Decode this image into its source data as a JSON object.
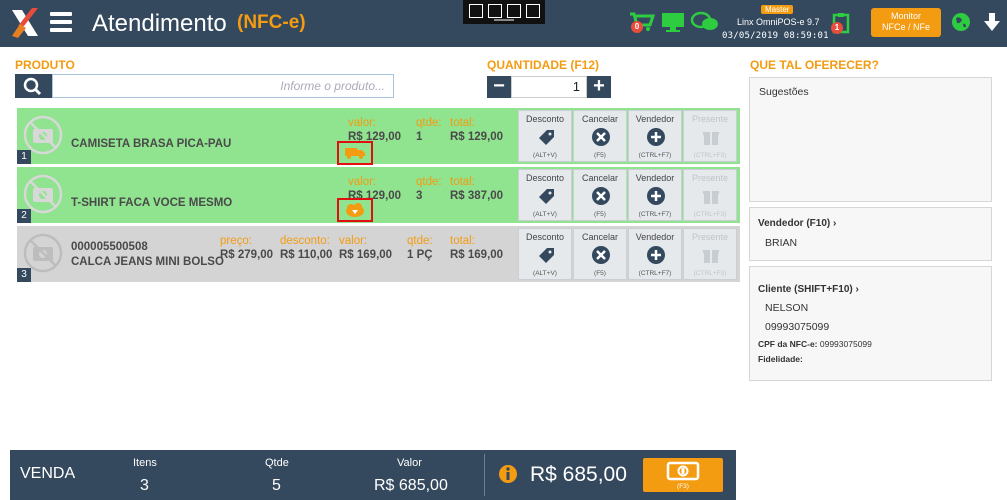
{
  "header": {
    "title": "Atendimento",
    "subtitle": "(NFC-e)",
    "cart_badge": "0",
    "notice_badge": "1",
    "master_badge": "Master",
    "app_version": "Linx OmniPOS-e  9.7",
    "datetime": "03/05/2019 08:59:01",
    "monitor_line1": "Monitor",
    "monitor_line2": "NFCe / NFe"
  },
  "search": {
    "label": "PRODUTO",
    "placeholder": "Informe o produto..."
  },
  "quantity": {
    "label": "QUANTIDADE (F12)",
    "value": "1"
  },
  "labels": {
    "valor": "valor:",
    "qtde": "qtde:",
    "total": "total:",
    "preco": "preço:",
    "desconto": "desconto:"
  },
  "actions": {
    "desconto": {
      "label": "Desconto",
      "key": "(ALT+V)"
    },
    "cancelar": {
      "label": "Cancelar",
      "key": "(F5)"
    },
    "vendedor": {
      "label": "Vendedor",
      "key": "(CTRL+F7)"
    },
    "presente": {
      "label": "Presente",
      "key": "(CTRL+F3)"
    }
  },
  "items": [
    {
      "index": "1",
      "name": "CAMISETA BRASA PICA-PAU",
      "valor": "R$ 129,00",
      "qtde": "1",
      "total": "R$ 129,00"
    },
    {
      "index": "2",
      "name": "T-SHIRT FACA VOCE MESMO",
      "valor": "R$ 129,00",
      "qtde": "3",
      "total": "R$ 387,00"
    },
    {
      "index": "3",
      "code": "000005500508",
      "name": "CALCA JEANS MINI BOLSO",
      "preco": "R$ 279,00",
      "desconto": "R$ 110,00",
      "valor": "R$ 169,00",
      "qtde": "1 PÇ",
      "total": "R$ 169,00"
    }
  ],
  "right_panel": {
    "heading": "QUE TAL OFERECER?",
    "sugestoes": "Sugestões",
    "vendedor_title": "Vendedor (F10)",
    "vendedor_name": "BRIAN",
    "cliente_title": "Cliente (SHIFT+F10)",
    "cliente_name": "NELSON",
    "cliente_phone": "09993075099",
    "cpf_label": "CPF da NFC-e:",
    "cpf_value": "09993075099",
    "fidelidade_label": "Fidelidade:",
    "chevron": "›"
  },
  "footer": {
    "venda": "VENDA",
    "itens_label": "Itens",
    "itens_value": "3",
    "qtde_label": "Qtde",
    "qtde_value": "5",
    "valor_label": "Valor",
    "valor_value": "R$ 685,00",
    "total": "R$ 685,00",
    "pay_key": "(F3)"
  },
  "colors": {
    "header_bg": "#34495e",
    "accent": "#f39c12",
    "row_active": "#90e38f",
    "row_inactive": "#d4d4d4",
    "highlight": "#e01010",
    "icon_green": "#2ecc40"
  }
}
